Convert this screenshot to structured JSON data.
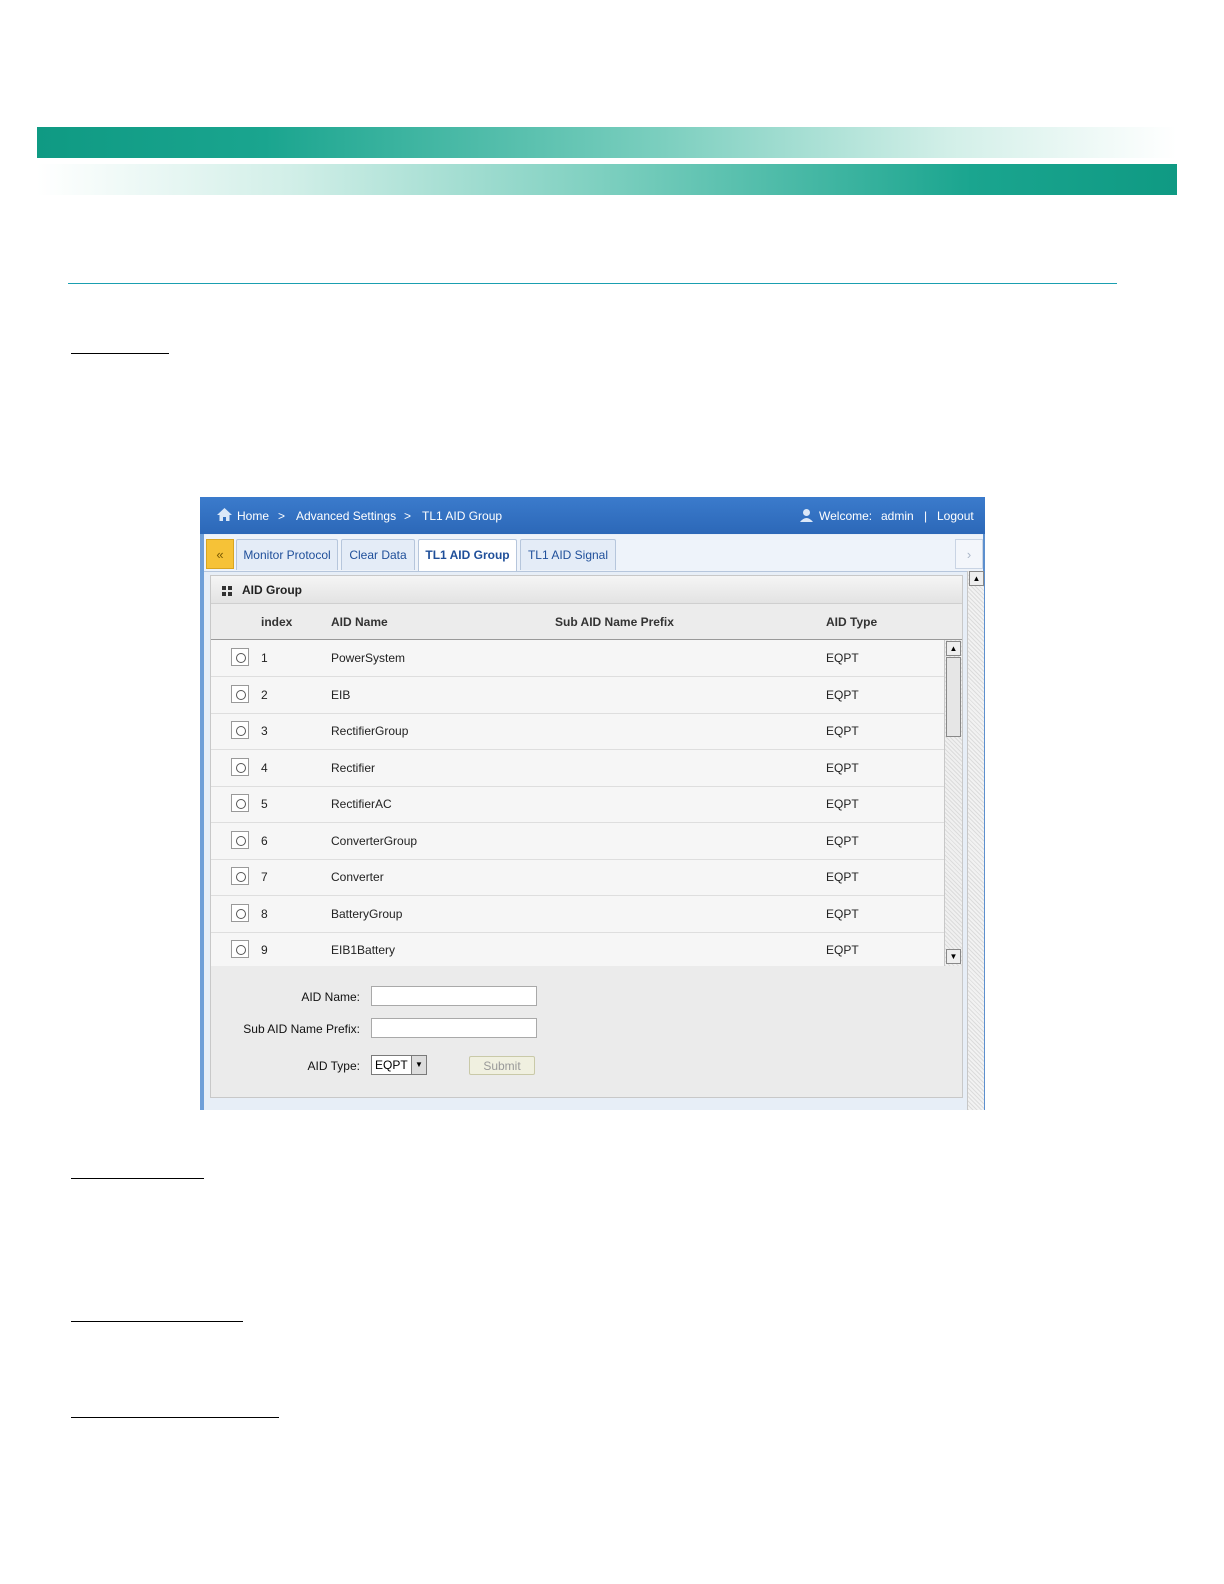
{
  "breadcrumb": {
    "home": "Home",
    "sep": ">",
    "section": "Advanced Settings",
    "page": "TL1 AID Group"
  },
  "user": {
    "welcome": "Welcome:",
    "name": "admin",
    "divider": "|",
    "logout": "Logout"
  },
  "tabs": [
    {
      "label": "Monitor Protocol",
      "active": false
    },
    {
      "label": "Clear Data",
      "active": false
    },
    {
      "label": "TL1 AID Group",
      "active": true
    },
    {
      "label": "TL1 AID Signal",
      "active": false
    }
  ],
  "panel": {
    "title": "AID Group",
    "columns": [
      "index",
      "AID Name",
      "Sub AID Name Prefix",
      "AID Type"
    ],
    "rows": [
      {
        "index": "1",
        "name": "PowerSystem",
        "prefix": "",
        "type": "EQPT"
      },
      {
        "index": "2",
        "name": "EIB",
        "prefix": "",
        "type": "EQPT"
      },
      {
        "index": "3",
        "name": "RectifierGroup",
        "prefix": "",
        "type": "EQPT"
      },
      {
        "index": "4",
        "name": "Rectifier",
        "prefix": "",
        "type": "EQPT"
      },
      {
        "index": "5",
        "name": "RectifierAC",
        "prefix": "",
        "type": "EQPT"
      },
      {
        "index": "6",
        "name": "ConverterGroup",
        "prefix": "",
        "type": "EQPT"
      },
      {
        "index": "7",
        "name": "Converter",
        "prefix": "",
        "type": "EQPT"
      },
      {
        "index": "8",
        "name": "BatteryGroup",
        "prefix": "",
        "type": "EQPT"
      },
      {
        "index": "9",
        "name": "EIB1Battery",
        "prefix": "",
        "type": "EQPT"
      }
    ]
  },
  "form": {
    "aid_name_label": "AID Name:",
    "aid_name_value": "",
    "sub_prefix_label": "Sub AID Name Prefix:",
    "sub_prefix_value": "",
    "aid_type_label": "AID Type:",
    "aid_type_value": "EQPT",
    "submit_label": "Submit"
  },
  "colors": {
    "topbar": "#2c68b8",
    "tab_text": "#1f4f9a",
    "accent_band": "#0f9a83",
    "rule": "#1a9fb0"
  },
  "icons": [
    "home-icon",
    "user-icon",
    "collapse-left-icon",
    "scroll-right-icon",
    "grid-icon",
    "scroll-up-icon",
    "scroll-down-icon",
    "dropdown-arrow-icon"
  ]
}
